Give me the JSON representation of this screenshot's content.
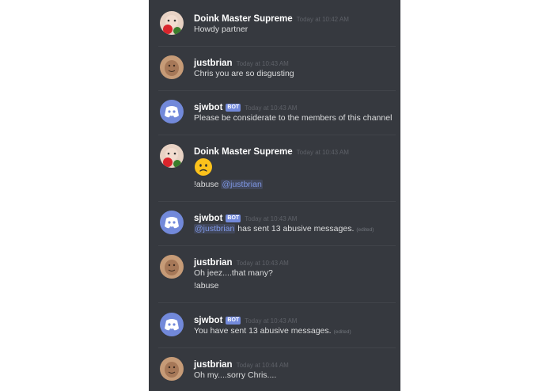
{
  "messages": [
    {
      "author": "Doink Master Supreme",
      "time": "Today at 10:42 AM",
      "lines": [
        "Howdy partner"
      ]
    },
    {
      "author": "justbrian",
      "time": "Today at 10:43 AM",
      "lines": [
        "Chris you are so disgusting"
      ]
    },
    {
      "author": "sjwbot",
      "bot_tag": "BOT",
      "time": "Today at 10:43 AM",
      "lines": [
        "Please be considerate to the members of this channel"
      ]
    },
    {
      "author": "Doink Master Supreme",
      "time": "Today at 10:43 AM",
      "emoji": "slightly-frowning-face",
      "command": "!abuse",
      "mention": "@justbrian"
    },
    {
      "author": "sjwbot",
      "bot_tag": "BOT",
      "time": "Today at 10:43 AM",
      "mention": "@justbrian",
      "text": "has sent 13 abusive messages.",
      "edited": "(edited)"
    },
    {
      "author": "justbrian",
      "time": "Today at 10:43 AM",
      "lines": [
        "Oh jeez....that many?",
        "!abuse"
      ]
    },
    {
      "author": "sjwbot",
      "bot_tag": "BOT",
      "time": "Today at 10:43 AM",
      "text": "You have sent 13 abusive messages.",
      "edited": "(edited)"
    },
    {
      "author": "justbrian",
      "time": "Today at 10:44 AM",
      "lines": [
        "Oh my....sorry Chris...."
      ]
    }
  ],
  "colors": {
    "background": "#36393f",
    "username": "#ffffff",
    "message_text": "#dcddde",
    "timestamp": "#5e6168",
    "bot_tag": "#7289da",
    "mention": "#7f98e6"
  },
  "avatars": [
    "doink-avatar-icon",
    "justbrian-avatar-icon",
    "discord-bot-avatar-icon"
  ]
}
